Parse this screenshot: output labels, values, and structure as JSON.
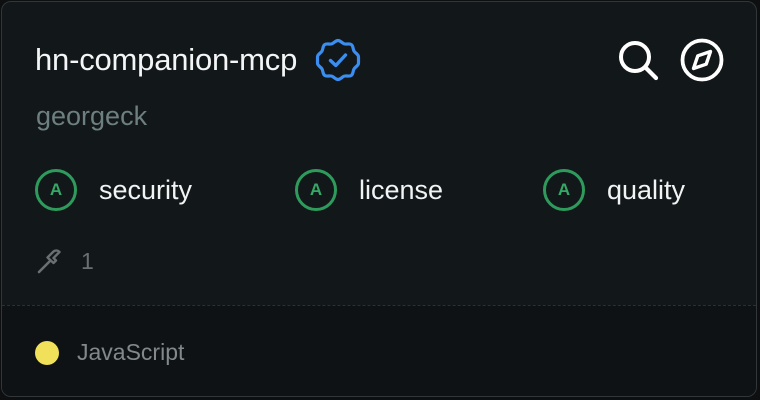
{
  "server": {
    "name": "hn-companion-mcp",
    "verified_icon": "verified-badge-icon",
    "author": "georgeck"
  },
  "actions": [
    {
      "icon": "search-icon"
    },
    {
      "icon": "compass-icon"
    }
  ],
  "grades": [
    {
      "grade": "A",
      "label": "security"
    },
    {
      "grade": "A",
      "label": "license"
    },
    {
      "grade": "A",
      "label": "quality"
    }
  ],
  "tools": {
    "icon": "hammer-icon",
    "count": "1"
  },
  "language": {
    "name": "JavaScript",
    "color": "#f1e05a"
  },
  "colors": {
    "background": "#121719",
    "verified": "#3b8ef0",
    "grade_green": "#2e9b5c",
    "muted_text": "#6d7f80"
  }
}
